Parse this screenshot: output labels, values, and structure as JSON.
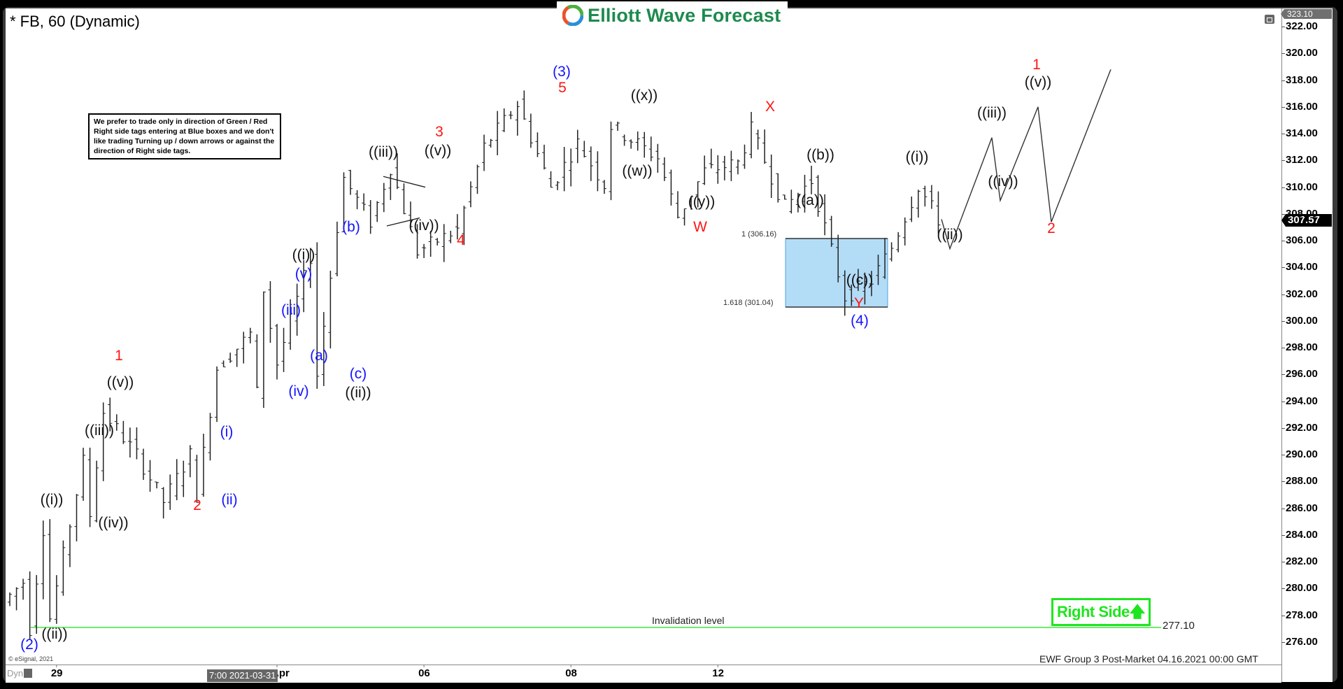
{
  "header": {
    "title": "* FB, 60 (Dynamic)",
    "logo_text": "Elliott Wave Forecast",
    "logo_icon": "ewf-swirl-icon"
  },
  "note": "We prefer to trade only in direction of Green / Red Right side tags entering at Blue boxes and we don't like trading Turning up / down arrows or against the direction of Right side tags.",
  "price_axis": {
    "top_tag": "323.10",
    "last_price_tag": "307.57"
  },
  "time_axis": {
    "cursor_time": "7:00 2021-03-31",
    "dyn_label": "Dyn"
  },
  "copyright": "© eSignal, 2021",
  "footer_stamp": "EWF Group 3 Post-Market 04.16.2021 00:00 GMT",
  "right_side_tag": {
    "label": "Right Side",
    "arrow": "up-arrow-icon",
    "color": "#1fe51f"
  },
  "invalidation": {
    "label": "Invalidation level",
    "value": "277.10",
    "color": "#3ee83e"
  },
  "fib_box": {
    "upper_label": "1 (306.16)",
    "lower_label": "1.618 (301.04)",
    "fill": "#b3dcf7",
    "stroke": "#4ba3e3"
  },
  "chart_data": {
    "type": "ohlc",
    "title": "* FB, 60 (Dynamic)",
    "xlabel": "",
    "ylabel": "",
    "ylim": [
      274.5,
      323.1
    ],
    "y_ticks": [
      "322.00",
      "320.00",
      "318.00",
      "316.00",
      "314.00",
      "312.00",
      "310.00",
      "308.00",
      "306.00",
      "304.00",
      "302.00",
      "300.00",
      "298.00",
      "296.00",
      "294.00",
      "292.00",
      "290.00",
      "288.00",
      "286.00",
      "284.00",
      "282.00",
      "280.00",
      "278.00",
      "276.00"
    ],
    "x_ticks": [
      {
        "label": "29",
        "bar": 7
      },
      {
        "label": "Apr",
        "bar": 40
      },
      {
        "label": "06",
        "bar": 62
      },
      {
        "label": "08",
        "bar": 84
      },
      {
        "label": "12",
        "bar": 106
      }
    ],
    "grid": false,
    "price_path": [
      {
        "bar": 0,
        "price": 279.0
      },
      {
        "bar": 3,
        "price": 280.5
      },
      {
        "bar": 4,
        "price": 277.0,
        "label": "(2)"
      },
      {
        "bar": 6,
        "price": 284.5,
        "label": "((i))"
      },
      {
        "bar": 7,
        "price": 277.8,
        "label": "((ii))"
      },
      {
        "bar": 12,
        "price": 289.5,
        "label": "((iii))"
      },
      {
        "bar": 13,
        "price": 285.5,
        "label": "((iv))"
      },
      {
        "bar": 15,
        "price": 293.2,
        "label": "((v)) / 1"
      },
      {
        "bar": 20,
        "price": 290.0
      },
      {
        "bar": 24,
        "price": 286.5,
        "label": "2"
      },
      {
        "bar": 28,
        "price": 290.0,
        "label": "(i)"
      },
      {
        "bar": 29,
        "price": 287.0,
        "label": "(ii)"
      },
      {
        "bar": 32,
        "price": 296.5
      },
      {
        "bar": 37,
        "price": 299.0,
        "label": "(iii)"
      },
      {
        "bar": 38,
        "price": 294.6,
        "label": "(iv)"
      },
      {
        "bar": 39,
        "price": 302.4,
        "label": "(v) / ((i))"
      },
      {
        "bar": 41,
        "price": 296.8,
        "label": "(a)"
      },
      {
        "bar": 46,
        "price": 304.8,
        "label": "(b)"
      },
      {
        "bar": 47,
        "price": 296.0,
        "label": "(c) / ((ii))"
      },
      {
        "bar": 51,
        "price": 310.7,
        "label": "((iii))"
      },
      {
        "bar": 55,
        "price": 307.4,
        "label": "((iv))"
      },
      {
        "bar": 58,
        "price": 311.5,
        "label": "((v)) / 3"
      },
      {
        "bar": 62,
        "price": 305.2,
        "label": "4"
      },
      {
        "bar": 68,
        "price": 306.8
      },
      {
        "bar": 72,
        "price": 313.0
      },
      {
        "bar": 77,
        "price": 316.2,
        "label": "5 / (3)"
      },
      {
        "bar": 82,
        "price": 310.0
      },
      {
        "bar": 86,
        "price": 313.3
      },
      {
        "bar": 90,
        "price": 310.2,
        "label": "((w))"
      },
      {
        "bar": 91,
        "price": 314.6,
        "label": "((x))"
      },
      {
        "bar": 98,
        "price": 312.2
      },
      {
        "bar": 101,
        "price": 307.8,
        "label": "((y)) / W"
      },
      {
        "bar": 105,
        "price": 311.2
      },
      {
        "bar": 110,
        "price": 311.8
      },
      {
        "bar": 112,
        "price": 314.3,
        "label": "X"
      },
      {
        "bar": 117,
        "price": 308.5,
        "label": "((a))"
      },
      {
        "bar": 121,
        "price": 310.5,
        "label": "((b))"
      },
      {
        "bar": 126,
        "price": 301.8,
        "label": "((c)) / Y / (4)"
      },
      {
        "bar": 130,
        "price": 303.0
      },
      {
        "bar": 133,
        "price": 305.5
      },
      {
        "bar": 137,
        "price": 310.1,
        "label": "((i))"
      },
      {
        "bar": 140,
        "price": 307.6
      }
    ],
    "projection": [
      {
        "label": "start",
        "price": 307.6
      },
      {
        "label": "((ii))",
        "price": 305.4
      },
      {
        "label": "((iii))",
        "price": 313.7
      },
      {
        "label": "((iv))",
        "price": 309.0
      },
      {
        "label": "((v)) / 1",
        "price": 316.0
      },
      {
        "label": "2",
        "price": 307.4
      },
      {
        "label": "end",
        "price": 318.8
      }
    ],
    "fib_levels": [
      {
        "ratio": "1",
        "price": 306.16
      },
      {
        "ratio": "1.618",
        "price": 301.04
      }
    ],
    "invalidation_level": 277.1,
    "last_price": 307.57
  },
  "wave_labels": [
    {
      "text": "(2)",
      "price": 275.8,
      "x": 42,
      "color": "blue"
    },
    {
      "text": "((ii))",
      "price": 276.6,
      "x": 78,
      "color": "black",
      "above": false
    },
    {
      "text": "((i))",
      "price": 286.6,
      "x": 74,
      "color": "black"
    },
    {
      "text": "((iii))",
      "price": 291.8,
      "x": 142,
      "color": "black"
    },
    {
      "text": "((iv))",
      "price": 284.9,
      "x": 162,
      "color": "black"
    },
    {
      "text": "((v))",
      "price": 295.4,
      "x": 172,
      "color": "black"
    },
    {
      "text": "1",
      "price": 297.4,
      "x": 170,
      "color": "red"
    },
    {
      "text": "2",
      "price": 286.2,
      "x": 282,
      "color": "red"
    },
    {
      "text": "(i)",
      "price": 291.7,
      "x": 324,
      "color": "blue"
    },
    {
      "text": "(ii)",
      "price": 286.6,
      "x": 328,
      "color": "blue"
    },
    {
      "text": "(iii)",
      "price": 300.8,
      "x": 416,
      "color": "blue"
    },
    {
      "text": "(iv)",
      "price": 294.7,
      "x": 427,
      "color": "blue"
    },
    {
      "text": "(v)",
      "price": 303.5,
      "x": 434,
      "color": "blue"
    },
    {
      "text": "((i))",
      "price": 304.9,
      "x": 434,
      "color": "black"
    },
    {
      "text": "(a)",
      "price": 297.4,
      "x": 456,
      "color": "blue"
    },
    {
      "text": "(b)",
      "price": 307.0,
      "x": 502,
      "color": "blue"
    },
    {
      "text": "(c)",
      "price": 296.0,
      "x": 512,
      "color": "blue"
    },
    {
      "text": "((ii))",
      "price": 294.6,
      "x": 512,
      "color": "black"
    },
    {
      "text": "((iii))",
      "price": 312.6,
      "x": 548,
      "color": "black"
    },
    {
      "text": "((iv))",
      "price": 307.1,
      "x": 606,
      "color": "black"
    },
    {
      "text": "((v))",
      "price": 312.7,
      "x": 626,
      "color": "black"
    },
    {
      "text": "3",
      "price": 314.1,
      "x": 628,
      "color": "red"
    },
    {
      "text": "4",
      "price": 306.0,
      "x": 659,
      "color": "red"
    },
    {
      "text": "5",
      "price": 317.4,
      "x": 804,
      "color": "red"
    },
    {
      "text": "(3)",
      "price": 318.6,
      "x": 803,
      "color": "blue"
    },
    {
      "text": "((w))",
      "price": 311.2,
      "x": 911,
      "color": "black"
    },
    {
      "text": "((x))",
      "price": 316.8,
      "x": 921,
      "color": "black"
    },
    {
      "text": "((y))",
      "price": 308.9,
      "x": 1003,
      "color": "black"
    },
    {
      "text": "W",
      "price": 307.0,
      "x": 1001,
      "color": "red"
    },
    {
      "text": "X",
      "price": 316.0,
      "x": 1101,
      "color": "red"
    },
    {
      "text": "((b))",
      "price": 312.4,
      "x": 1173,
      "color": "black"
    },
    {
      "text": "((a))",
      "price": 309.0,
      "x": 1158,
      "color": "black"
    },
    {
      "text": "((c))",
      "price": 303.0,
      "x": 1229,
      "color": "black"
    },
    {
      "text": "Y",
      "price": 301.3,
      "x": 1228,
      "color": "red"
    },
    {
      "text": "(4)",
      "price": 300.0,
      "x": 1229,
      "color": "blue"
    },
    {
      "text": "((i))",
      "price": 312.2,
      "x": 1311,
      "color": "black"
    },
    {
      "text": "((ii))",
      "price": 306.4,
      "x": 1358,
      "color": "black"
    },
    {
      "text": "((iii))",
      "price": 315.5,
      "x": 1418,
      "color": "black"
    },
    {
      "text": "((iv))",
      "price": 310.4,
      "x": 1434,
      "color": "black"
    },
    {
      "text": "((v))",
      "price": 317.8,
      "x": 1484,
      "color": "black"
    },
    {
      "text": "1",
      "price": 319.1,
      "x": 1482,
      "color": "red"
    },
    {
      "text": "2",
      "price": 306.9,
      "x": 1503,
      "color": "red"
    }
  ]
}
